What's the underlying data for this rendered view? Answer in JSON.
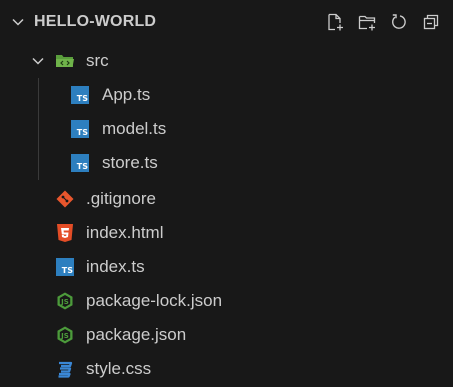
{
  "explorer": {
    "title": "HELLO-WORLD",
    "actions": [
      {
        "name": "new-file-icon"
      },
      {
        "name": "new-folder-icon"
      },
      {
        "name": "refresh-icon"
      },
      {
        "name": "collapse-all-icon"
      }
    ]
  },
  "tree": {
    "folder": {
      "label": "src",
      "icon": "folder-src-icon",
      "expanded": true
    },
    "folder_children": [
      {
        "label": "App.ts",
        "icon": "typescript-icon"
      },
      {
        "label": "model.ts",
        "icon": "typescript-icon"
      },
      {
        "label": "store.ts",
        "icon": "typescript-icon"
      }
    ],
    "root_files": [
      {
        "label": ".gitignore",
        "icon": "git-icon"
      },
      {
        "label": "index.html",
        "icon": "html5-icon"
      },
      {
        "label": "index.ts",
        "icon": "typescript-icon"
      },
      {
        "label": "package-lock.json",
        "icon": "nodejs-icon"
      },
      {
        "label": "package.json",
        "icon": "nodejs-icon"
      },
      {
        "label": "style.css",
        "icon": "css3-icon"
      }
    ]
  },
  "colors": {
    "background": "#181818",
    "text": "#cccccc",
    "typescript": "#2d7fbf",
    "git": "#e8562d",
    "html5": "#e44d26",
    "nodejs": "#4c9b3b",
    "css3": "#3a87d6",
    "folder": "#5a9e3c"
  }
}
